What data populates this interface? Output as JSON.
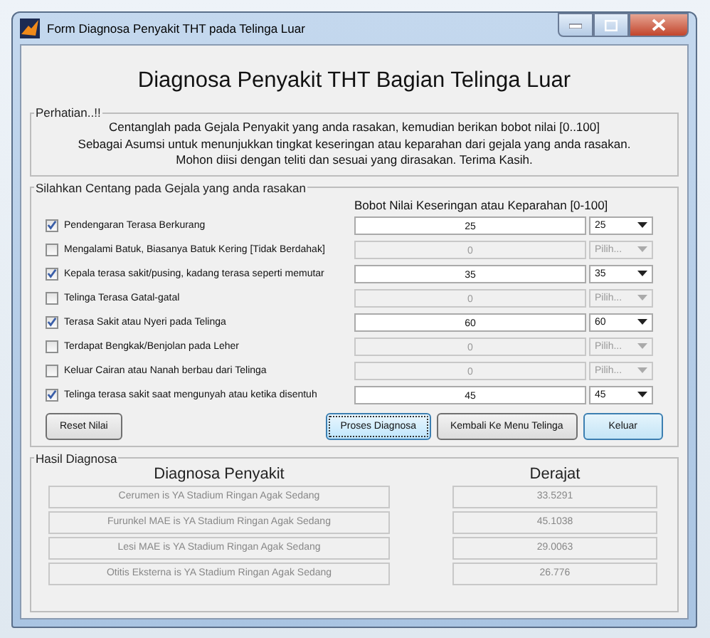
{
  "window": {
    "title": "Form Diagnosa Penyakit THT pada Telinga Luar"
  },
  "heading": "Diagnosa Penyakit THT Bagian Telinga Luar",
  "notice": {
    "legend": "Perhatian..!!",
    "lines": [
      "Centanglah pada Gejala Penyakit yang anda rasakan, kemudian berikan bobot nilai [0..100]",
      "Sebagai Asumsi untuk menunjukkan tingkat keseringan atau keparahan dari gejala yang anda rasakan.",
      "Mohon diisi dengan teliti dan sesuai yang dirasakan. Terima Kasih."
    ]
  },
  "symptoms": {
    "legend": "Silahkan Centang pada Gejala yang anda rasakan",
    "column_header": "Bobot Nilai Keseringan atau Keparahan [0-100]",
    "rows": [
      {
        "label": "Pendengaran Terasa Berkurang",
        "checked": true,
        "value": "25",
        "choice": "25"
      },
      {
        "label": "Mengalami Batuk, Biasanya Batuk Kering [Tidak Berdahak]",
        "checked": false,
        "value": "0",
        "choice": "Pilih..."
      },
      {
        "label": "Kepala terasa sakit/pusing, kadang terasa seperti memutar",
        "checked": true,
        "value": "35",
        "choice": "35"
      },
      {
        "label": "Telinga Terasa Gatal-gatal",
        "checked": false,
        "value": "0",
        "choice": "Pilih..."
      },
      {
        "label": "Terasa Sakit atau Nyeri pada Telinga",
        "checked": true,
        "value": "60",
        "choice": "60"
      },
      {
        "label": "Terdapat Bengkak/Benjolan pada Leher",
        "checked": false,
        "value": "0",
        "choice": "Pilih..."
      },
      {
        "label": "Keluar Cairan atau Nanah berbau dari Telinga",
        "checked": false,
        "value": "0",
        "choice": "Pilih..."
      },
      {
        "label": "Telinga terasa sakit saat mengunyah atau ketika disentuh",
        "checked": true,
        "value": "45",
        "choice": "45"
      }
    ]
  },
  "buttons": [
    {
      "label": "Reset Nilai",
      "focused": false,
      "default": false
    },
    {
      "label": "Proses Diagnosa",
      "focused": true,
      "default": false
    },
    {
      "label": "Kembali Ke Menu Telinga",
      "focused": false,
      "default": false
    },
    {
      "label": "Keluar",
      "focused": false,
      "default": true
    }
  ],
  "results": {
    "legend": "Hasil Diagnosa",
    "diagnosis_header": "Diagnosa Penyakit",
    "degree_header": "Derajat",
    "rows": [
      {
        "diagnosis": "Cerumen is YA Stadium Ringan Agak Sedang",
        "degree": "33.5291"
      },
      {
        "diagnosis": "Furunkel MAE is YA Stadium Ringan Agak Sedang",
        "degree": "45.1038"
      },
      {
        "diagnosis": "Lesi MAE is YA Stadium Ringan Agak Sedang",
        "degree": "29.0063"
      },
      {
        "diagnosis": "Otitis Eksterna is YA Stadium Ringan Agak Sedang",
        "degree": "26.776"
      }
    ]
  }
}
